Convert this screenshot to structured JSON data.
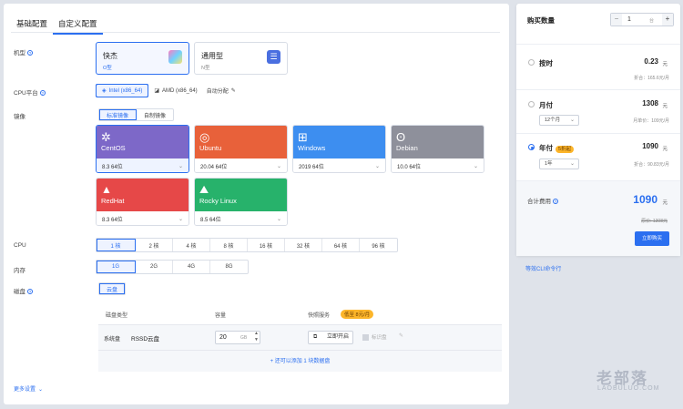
{
  "tabs": [
    "基础配置",
    "自定义配置"
  ],
  "labels": {
    "model": "机型",
    "cpu_platform": "CPU平台",
    "image": "镜像",
    "cpu": "CPU",
    "memory": "内存",
    "disk": "磁盘",
    "more": "更多设置"
  },
  "models": [
    {
      "name": "快杰",
      "sub": "O型"
    },
    {
      "name": "通用型",
      "sub": "N型"
    }
  ],
  "cpu_platforms": [
    "Intel (x86_64)",
    "AMD (x86_64)",
    "自动分配"
  ],
  "image_tabs": [
    "标准镜像",
    "自制镜像"
  ],
  "os": [
    {
      "name": "CentOS",
      "version": "8.3 64位",
      "color": "#7d68c8"
    },
    {
      "name": "Ubuntu",
      "version": "20.04 64位",
      "color": "#e8613a"
    },
    {
      "name": "Windows",
      "version": "2019 64位",
      "color": "#3d8ef0"
    },
    {
      "name": "Debian",
      "version": "10.0 64位",
      "color": "#8e909b"
    },
    {
      "name": "RedHat",
      "version": "8.3 64位",
      "color": "#e64848"
    },
    {
      "name": "Rocky Linux",
      "version": "8.5 64位",
      "color": "#27b26b"
    }
  ],
  "cpu_options": [
    "1 核",
    "2 核",
    "4 核",
    "8 核",
    "16 核",
    "32 核",
    "64 核",
    "96 核"
  ],
  "mem_options": [
    "1G",
    "2G",
    "4G",
    "8G"
  ],
  "disk": {
    "tab": "云盘",
    "headers": [
      "磁盘类型",
      "容量",
      "快照服务"
    ],
    "badge": "低至 8元/月",
    "row_type": "系统盘",
    "row_name": "RSSD云盘",
    "size": "20",
    "unit": "GB",
    "snapshot": "立即开启",
    "mark": "标识盘",
    "add": "+ 还可以添加 1 块数据盘"
  },
  "side": {
    "title": "购买数量",
    "qty": "1",
    "qty_unit": "台",
    "options": [
      {
        "title": "按时",
        "price": "0.23",
        "unit": "元",
        "note": "折合：165.6元/月"
      },
      {
        "title": "月付",
        "price": "1308",
        "unit": "元",
        "note": "月单价：109元/月",
        "select": "12个月"
      },
      {
        "title": "年付",
        "badge": "5折起",
        "price": "1090",
        "unit": "元",
        "note": "折合：90.83元/月",
        "select": "1年"
      }
    ],
    "total_label": "合计费用",
    "total": "1090",
    "total_unit": "元",
    "original": "原价: 1308元",
    "buy": "立即购买",
    "link": "等效CLI命令行"
  },
  "watermark": {
    "big": "老部落",
    "small": "LAOBULUO.COM"
  }
}
